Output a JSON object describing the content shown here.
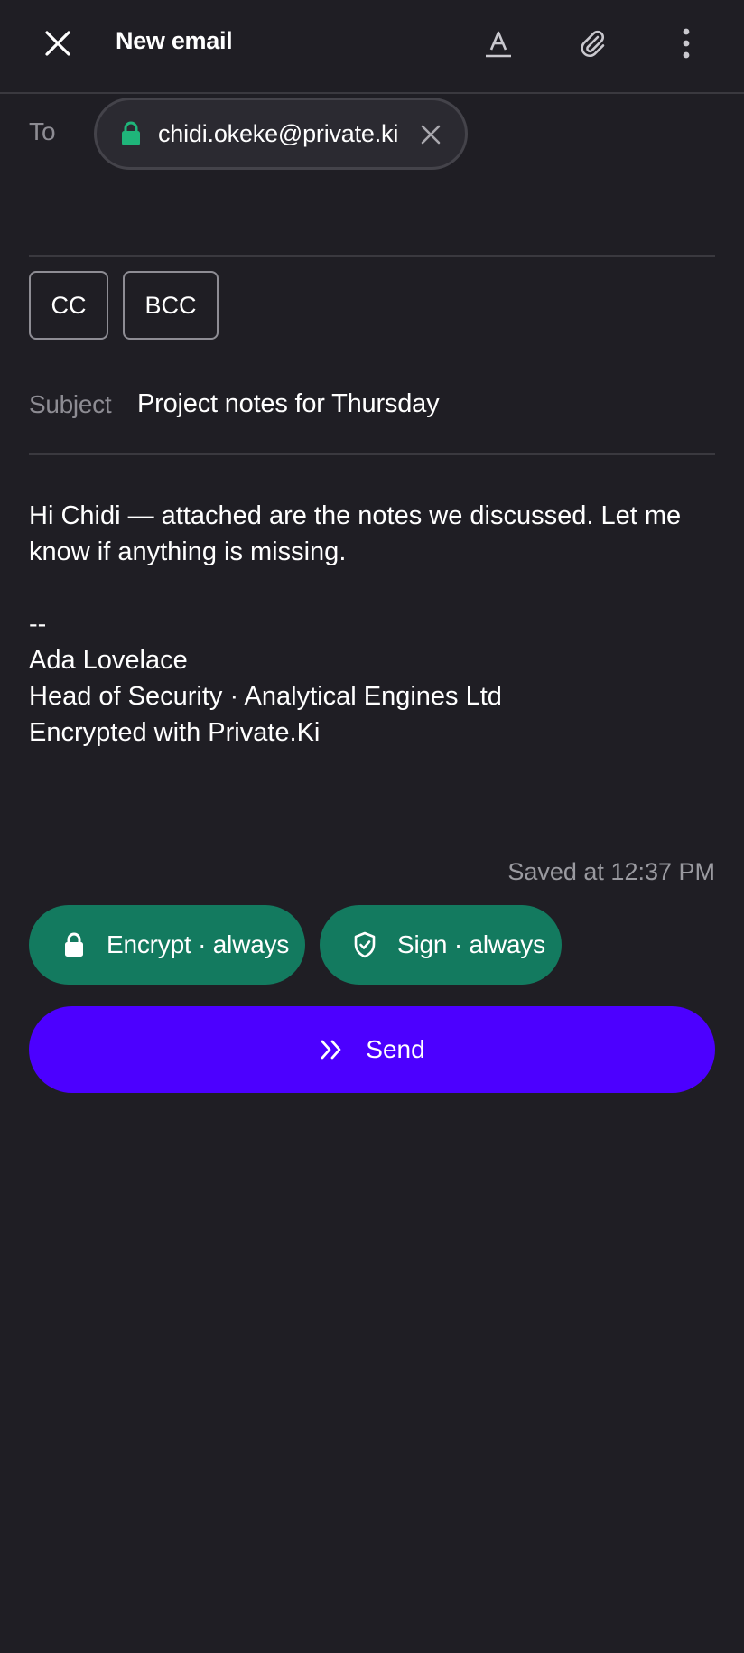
{
  "header": {
    "title": "New email",
    "close_icon": "close-icon",
    "format_icon": "text-format-icon",
    "attach_icon": "paperclip-icon",
    "more_icon": "more-vertical-icon"
  },
  "compose": {
    "to_label": "To",
    "recipient": "chidi.okeke@private.ki",
    "cc_label": "CC",
    "bcc_label": "BCC",
    "subject_label": "Subject",
    "subject_value": "Project notes for Thursday",
    "body": {
      "line1": "Hi Chidi — attached are the notes we discussed. Let me know if anything is missing.",
      "sig_separator": "--",
      "sig_name": "Ada Lovelace",
      "sig_title": "Head of Security · Analytical Engines Ltd",
      "sig_footer": "Encrypted with Private.Ki"
    }
  },
  "status": {
    "saved": "Saved at 12:37 PM"
  },
  "actions": {
    "encrypt_label": "Encrypt · always",
    "sign_label": "Sign · always",
    "send_label": "Send"
  },
  "colors": {
    "background": "#1f1e24",
    "accent_green": "#137a5f",
    "send_purple": "#4c00ff",
    "lock_green": "#1fb57a"
  }
}
